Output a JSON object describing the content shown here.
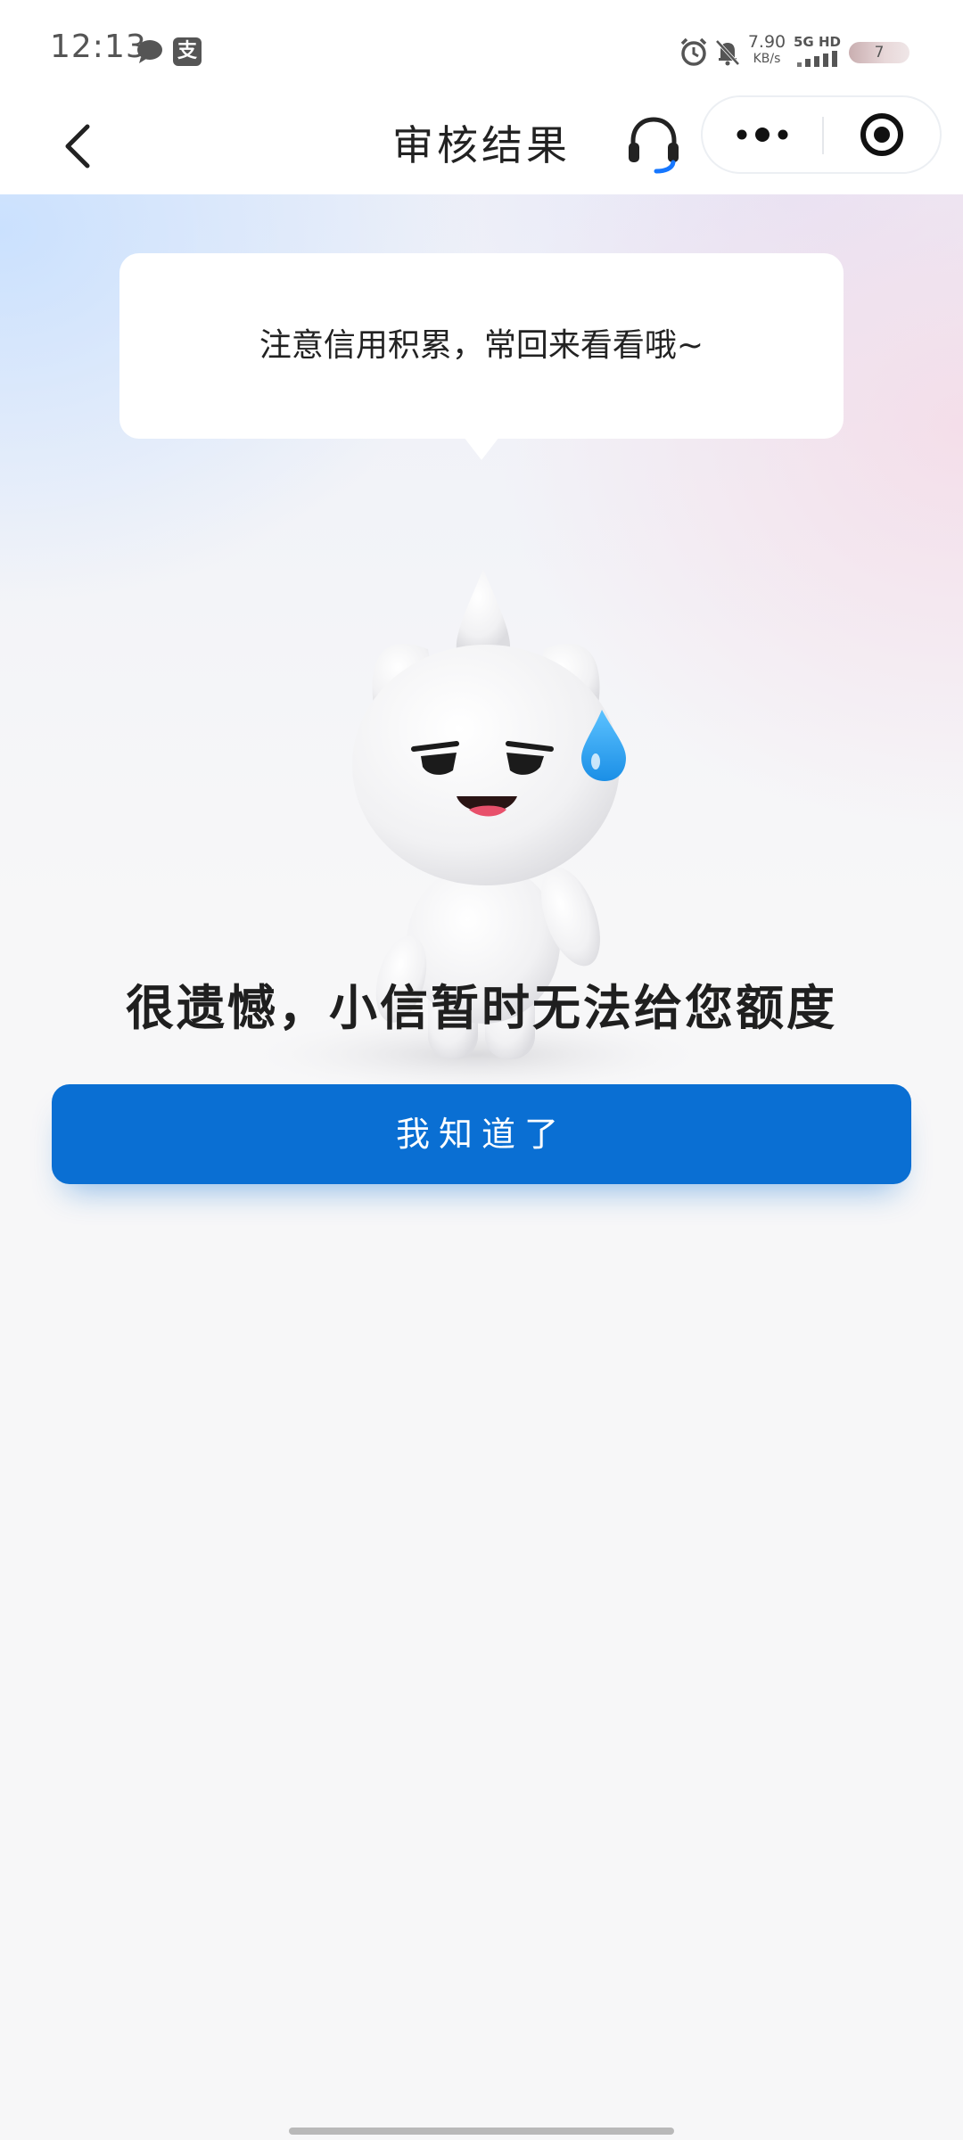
{
  "status_bar": {
    "time": "12:13",
    "pay_glyph": "支",
    "net_speed_value": "7.90",
    "net_speed_unit": "KB/s",
    "network_type": "5G HD",
    "battery_level": "7",
    "icons": [
      "chat-bubble-icon",
      "alipay-icon",
      "alarm-icon",
      "bell-off-icon",
      "signal-icon",
      "battery-icon"
    ]
  },
  "nav": {
    "title": "审核结果",
    "icons": [
      "back-chevron-icon",
      "headset-icon",
      "more-dots-icon",
      "close-target-icon"
    ]
  },
  "main": {
    "bubble_text": "注意信用积累，常回来看看哦~",
    "headline": "很遗憾，小信暂时无法给您额度",
    "button_label": "我知道了"
  },
  "colors": {
    "accent": "#0a6fd3",
    "headset_accent": "#1677ff",
    "sweat_drop": "#2aa3f2",
    "text_primary": "#222222",
    "page_background": "#f7f7f8"
  }
}
